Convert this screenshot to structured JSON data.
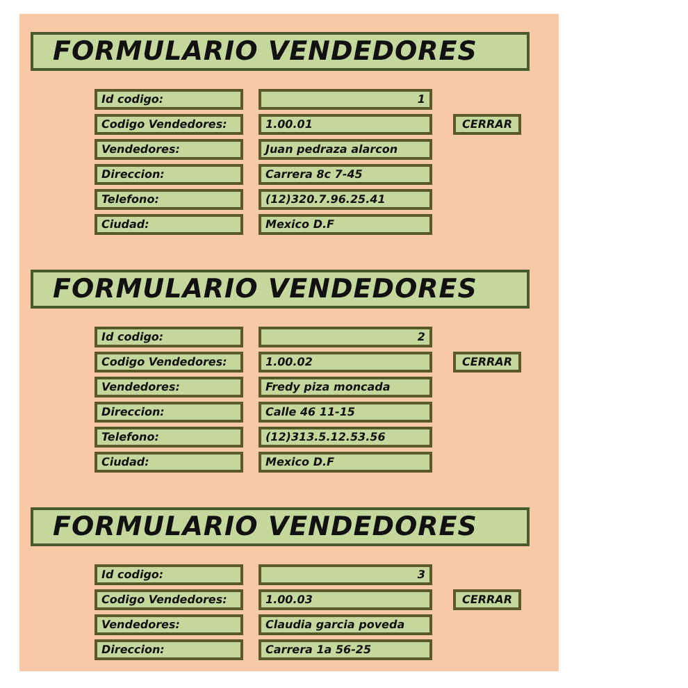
{
  "forms": [
    {
      "title": "FORMULARIO VENDEDORES",
      "rows": [
        {
          "kind": "number",
          "label": "Id codigo:",
          "value": "1"
        },
        {
          "kind": "text",
          "label": "Codigo Vendedores:",
          "value": "1.00.01",
          "button": "CERRAR"
        },
        {
          "kind": "text",
          "label": "Vendedores:",
          "value": "Juan pedraza alarcon"
        },
        {
          "kind": "text",
          "label": "Direccion:",
          "value": "Carrera 8c 7-45"
        },
        {
          "kind": "text",
          "label": "Telefono:",
          "value": "(12)320.7.96.25.41"
        },
        {
          "kind": "text",
          "label": "Ciudad:",
          "value": "Mexico D.F"
        }
      ]
    },
    {
      "title": "FORMULARIO VENDEDORES",
      "rows": [
        {
          "kind": "number",
          "label": "Id codigo:",
          "value": "2"
        },
        {
          "kind": "text",
          "label": "Codigo Vendedores:",
          "value": "1.00.02",
          "button": "CERRAR"
        },
        {
          "kind": "text",
          "label": "Vendedores:",
          "value": "Fredy piza moncada"
        },
        {
          "kind": "text",
          "label": "Direccion:",
          "value": "Calle 46 11-15"
        },
        {
          "kind": "text",
          "label": "Telefono:",
          "value": "(12)313.5.12.53.56"
        },
        {
          "kind": "text",
          "label": "Ciudad:",
          "value": "Mexico D.F"
        }
      ]
    },
    {
      "title": "FORMULARIO VENDEDORES",
      "rows": [
        {
          "kind": "number",
          "label": "Id codigo:",
          "value": "3"
        },
        {
          "kind": "text",
          "label": "Codigo Vendedores:",
          "value": "1.00.03",
          "button": "CERRAR"
        },
        {
          "kind": "text",
          "label": "Vendedores:",
          "value": "Claudia garcia poveda"
        },
        {
          "kind": "text",
          "label": "Direccion:",
          "value": "Carrera 1a 56-25"
        }
      ]
    }
  ]
}
